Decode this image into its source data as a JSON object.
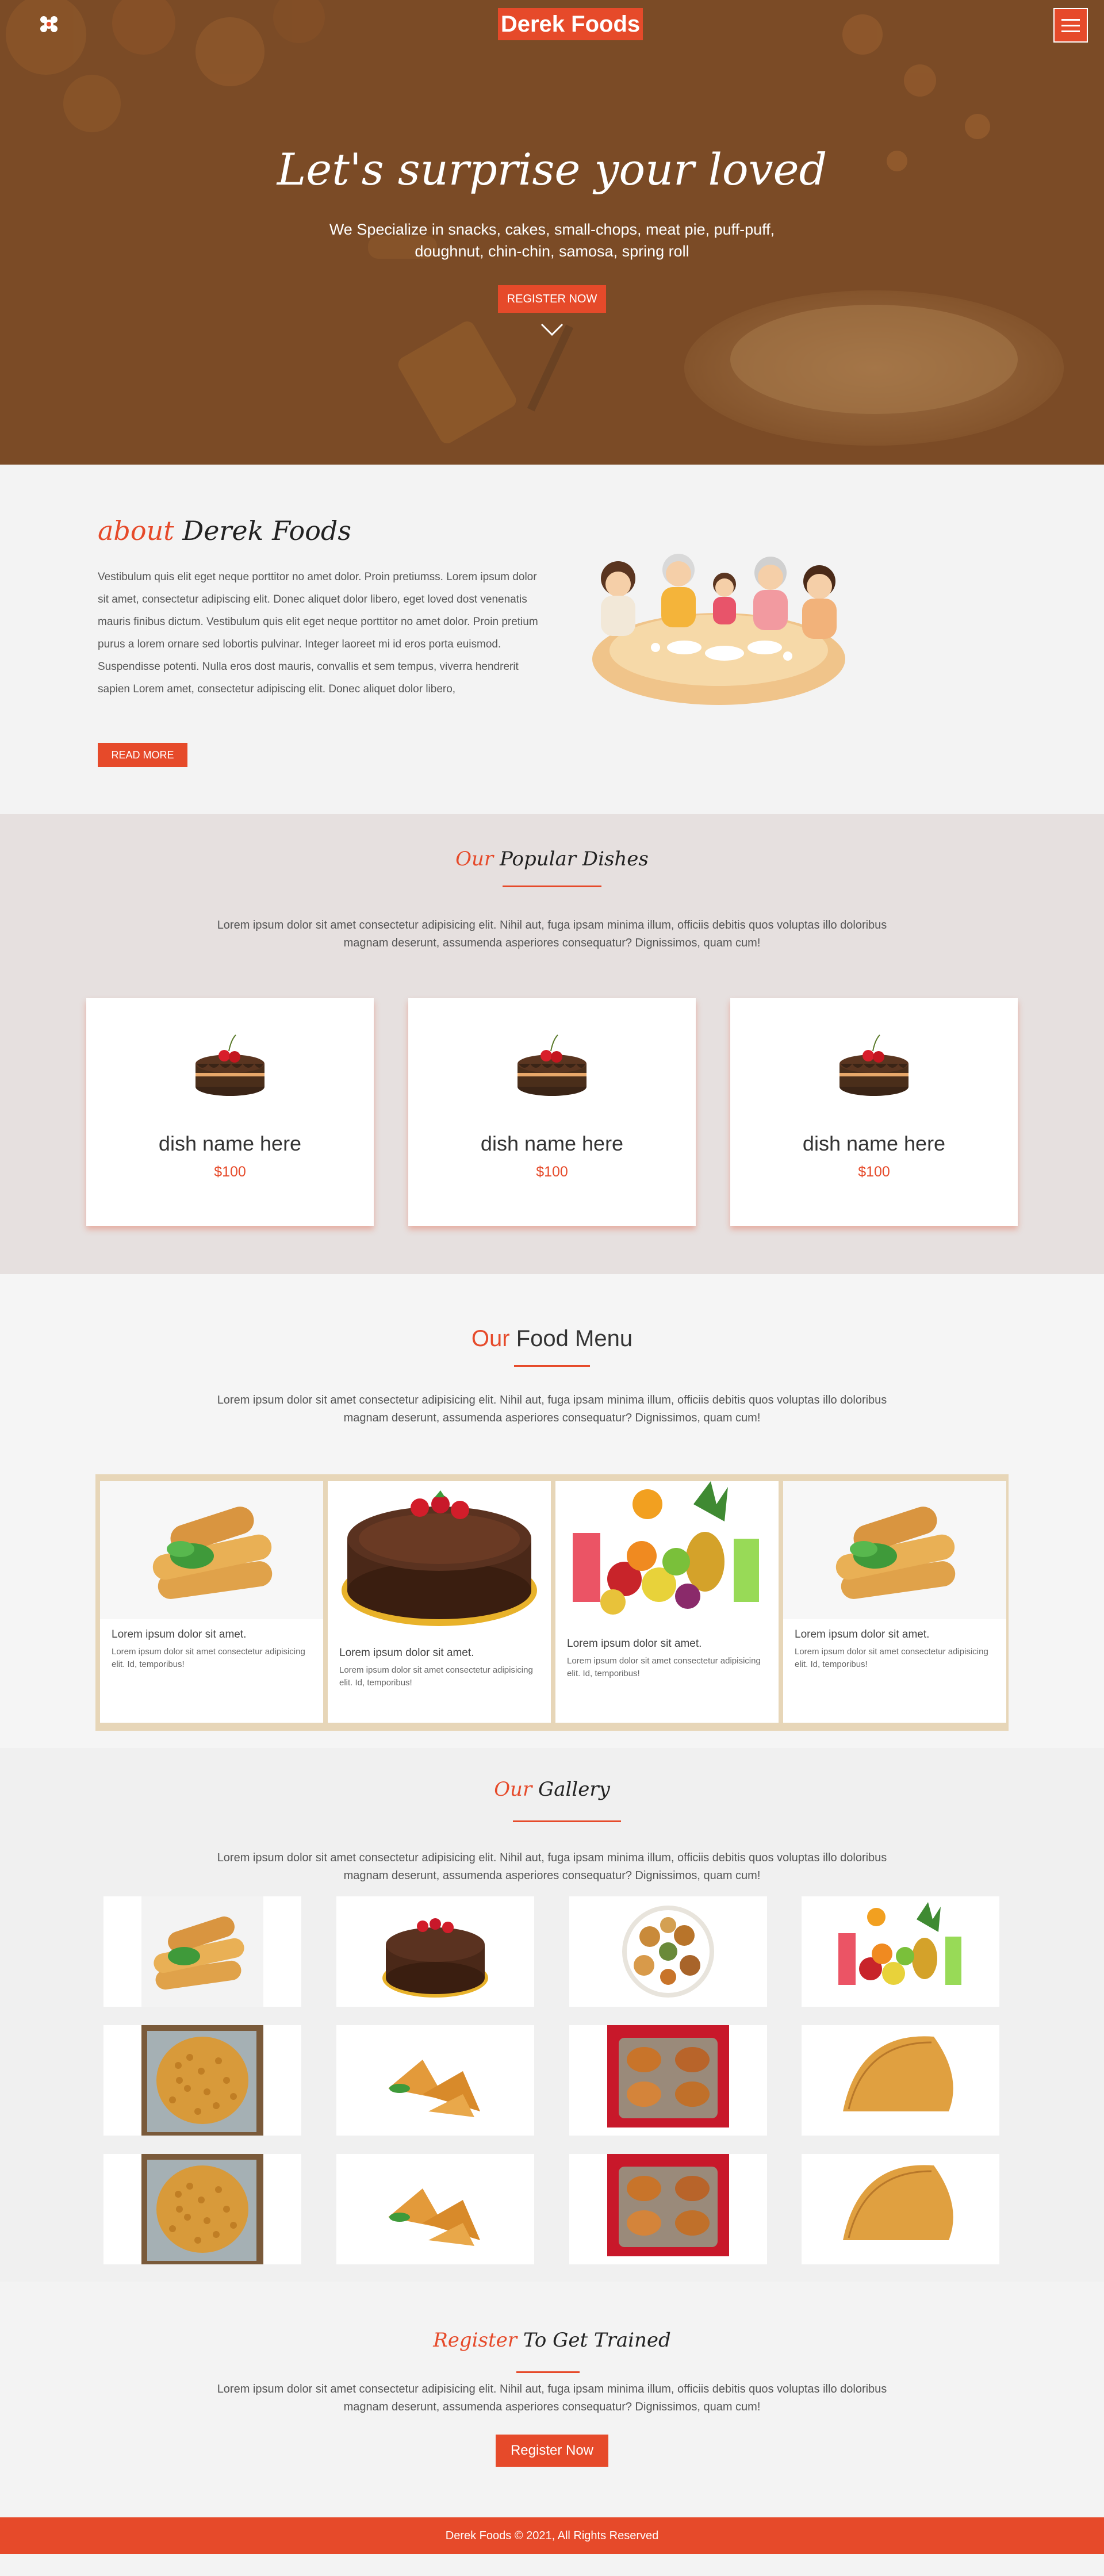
{
  "colors": {
    "accent": "#e64a2a",
    "hero_overlay": "#7a4a25",
    "card_frame": "#e7d6b8"
  },
  "header": {
    "logo": "Derek Foods",
    "left_icon": "flower-logo-icon",
    "menu_icon": "hamburger-icon"
  },
  "hero": {
    "title": "Let's surprise your loved",
    "subtitle": "We Specialize in snacks, cakes, small-chops, meat pie, puff-puff, doughnut, chin-chin, samosa, spring roll",
    "button": "REGISTER NOW",
    "scroll_icon": "chevron-down-icon"
  },
  "about": {
    "title_accent": "about",
    "title_rest": "Derek Foods",
    "text": "Vestibulum quis elit eget neque porttitor no amet dolor. Proin pretiumss. Lorem ipsum dolor sit amet, consectetur adipiscing elit. Donec aliquet dolor libero, eget loved dost venenatis mauris finibus dictum. Vestibulum quis elit eget neque porttitor no amet dolor. Proin pretium purus a lorem ornare sed lobortis pulvinar. Integer laoreet mi id eros porta euismod. Suspendisse potenti. Nulla eros dost mauris, convallis et sem tempus, viverra hendrerit sapien Lorem amet, consectetur adipiscing elit. Donec aliquet dolor libero,",
    "button": "READ MORE"
  },
  "popular": {
    "title_accent": "Our",
    "title_rest": "Popular Dishes",
    "desc": "Lorem ipsum dolor sit amet consectetur adipisicing elit. Nihil aut, fuga ipsam minima illum, officiis debitis quos voluptas illo doloribus magnam deserunt, assumenda asperiores consequatur? Dignissimos, quam cum!",
    "dishes": [
      {
        "name": "dish name here",
        "price": "$100"
      },
      {
        "name": "dish name here",
        "price": "$100"
      },
      {
        "name": "dish name here",
        "price": "$100"
      }
    ]
  },
  "food_menu": {
    "title_accent": "Our",
    "title_rest": "Food Menu",
    "desc": "Lorem ipsum dolor sit amet consectetur adipisicing elit. Nihil aut, fuga ipsam minima illum, officiis debitis quos voluptas illo doloribus magnam deserunt, assumenda asperiores consequatur? Dignissimos, quam cum!",
    "items": [
      {
        "name": "Lorem ipsum dolor sit amet.",
        "desc": "Lorem ipsum dolor sit amet consectetur adipisicing elit. Id, temporibus!"
      },
      {
        "name": "Lorem ipsum dolor sit amet.",
        "desc": "Lorem ipsum dolor sit amet consectetur adipisicing elit. Id, temporibus!"
      },
      {
        "name": "Lorem ipsum dolor sit amet.",
        "desc": "Lorem ipsum dolor sit amet consectetur adipisicing elit. Id, temporibus!"
      },
      {
        "name": "Lorem ipsum dolor sit amet.",
        "desc": "Lorem ipsum dolor sit amet consectetur adipisicing elit. Id, temporibus!"
      }
    ]
  },
  "gallery": {
    "title_accent": "Our",
    "title_rest": "Gallery",
    "desc": "Lorem ipsum dolor sit amet consectetur adipisicing elit. Nihil aut, fuga ipsam minima illum, officiis debitis quos voluptas illo doloribus magnam deserunt, assumenda asperiores consequatur? Dignissimos, quam cum!",
    "images": [
      "spring-rolls",
      "chocolate-cake",
      "small-chops-platter",
      "fruit-drinks",
      "chin-chin-bag",
      "samosa",
      "meat-pie-tray",
      "meat-pie",
      "chin-chin-bag",
      "samosa",
      "meat-pie-tray",
      "meat-pie"
    ]
  },
  "register": {
    "title_accent": "Register",
    "title_rest": "To Get Trained",
    "desc": "Lorem ipsum dolor sit amet consectetur adipisicing elit. Nihil aut, fuga ipsam minima illum, officiis debitis quos voluptas illo doloribus magnam deserunt, assumenda asperiores consequatur? Dignissimos, quam cum!",
    "button": "Register Now"
  },
  "footer": {
    "text": "Derek Foods © 2021, All Rights Reserved"
  }
}
